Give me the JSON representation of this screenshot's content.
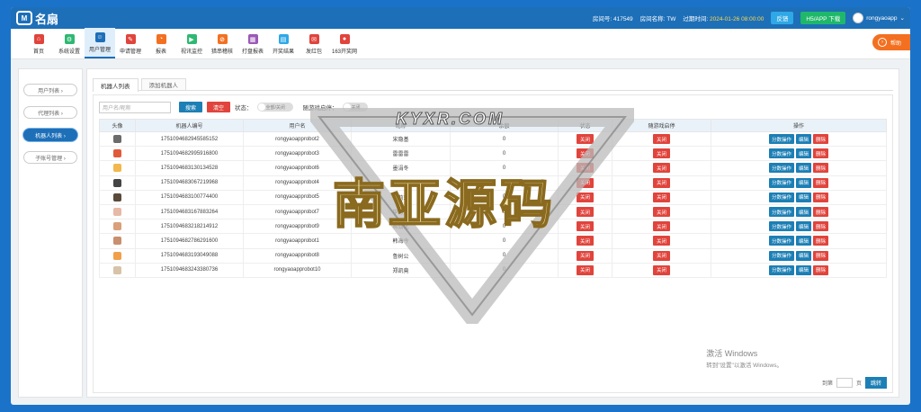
{
  "app": {
    "logo_badge": "M",
    "logo_text": "名扇"
  },
  "topbar": {
    "room_no_label": "房间号:",
    "room_no": "417549",
    "room_name_label": "房间名称:",
    "room_name": "TW",
    "expire_label": "过期时间:",
    "expire": "2024-01-26 08:00:00",
    "feedback": "反馈",
    "h5_download": "H5/APP 下载",
    "user": "rongyaoapp"
  },
  "nav": [
    {
      "label": "首页",
      "color": "#e0443c",
      "glyph": "⌂"
    },
    {
      "label": "系统设置",
      "color": "#2eb872",
      "glyph": "⚙"
    },
    {
      "label": "用户管理",
      "color": "#1d6fb8",
      "glyph": "☺"
    },
    {
      "label": "申请管理",
      "color": "#e0443c",
      "glyph": "✎"
    },
    {
      "label": "报表",
      "color": "#f37021",
      "glyph": "◔"
    },
    {
      "label": "视讯监控",
      "color": "#2eb872",
      "glyph": "▶"
    },
    {
      "label": "猎串稽核",
      "color": "#f37021",
      "glyph": "⊘"
    },
    {
      "label": "打盘报表",
      "color": "#9b59b6",
      "glyph": "▦"
    },
    {
      "label": "开奖结果",
      "color": "#2ea8e6",
      "glyph": "▤"
    },
    {
      "label": "发红包",
      "color": "#e0443c",
      "glyph": "✉"
    },
    {
      "label": "163开奖网",
      "color": "#e0443c",
      "glyph": "●"
    }
  ],
  "help_label": "帮助",
  "sidebar": [
    {
      "label": "用户列表 ›"
    },
    {
      "label": "代理列表 ›"
    },
    {
      "label": "机器人列表 ›"
    },
    {
      "label": "子账号管理 ›"
    }
  ],
  "tabs": [
    "机器人列表",
    "添加机器人"
  ],
  "filter": {
    "placeholder": "用户名/昵称",
    "search": "搜索",
    "clear": "清空",
    "status_label": "状态：",
    "status_toggle": "全部/关闭",
    "follow_label": "随游戏启停：",
    "follow_toggle": "关闭"
  },
  "table": {
    "headers": [
      "头像",
      "机器人编号",
      "用户名",
      "昵称",
      "余额",
      "状态",
      "随游戏启停",
      "操作"
    ],
    "rows": [
      {
        "avatar": "#6b6b6b",
        "id": "1751094682945585152",
        "user": "rongyaoapprobot2",
        "nick": "宋隐基",
        "bal": "0"
      },
      {
        "avatar": "#e05a3a",
        "id": "1751094682995916800",
        "user": "rongyaoapprobot3",
        "nick": "雷雷雷",
        "bal": "0"
      },
      {
        "avatar": "#f2b84b",
        "id": "1751094683130134528",
        "user": "rongyaoapprobot6",
        "nick": "墨涓冬",
        "bal": "0"
      },
      {
        "avatar": "#444444",
        "id": "1751094683067219968",
        "user": "rongyaoapprobot4",
        "nick": "鲁酒旺",
        "bal": "0"
      },
      {
        "avatar": "#5a4a3a",
        "id": "1751094683100774400",
        "user": "rongyaoapprobot5",
        "nick": "苗莉莉",
        "bal": "0"
      },
      {
        "avatar": "#e7b9a6",
        "id": "1751094683167883264",
        "user": "rongyaoapprobot7",
        "nick": "毕可动",
        "bal": "0"
      },
      {
        "avatar": "#d9a07a",
        "id": "1751094683218214912",
        "user": "rongyaoapprobot9",
        "nick": "蒋劲化",
        "bal": "0"
      },
      {
        "avatar": "#c98f6e",
        "id": "1751094682786291600",
        "user": "rongyaoapprobot1",
        "nick": "韩海今",
        "bal": "0"
      },
      {
        "avatar": "#f0a04b",
        "id": "1751094683193049088",
        "user": "rongyaoapprobot8",
        "nick": "鲁树公",
        "bal": "0"
      },
      {
        "avatar": "#d8c2a8",
        "id": "1751094683243380736",
        "user": "rongyaoapprobot10",
        "nick": "郑凯竟",
        "bal": "0"
      }
    ],
    "status_btn": "关闭",
    "follow_btn": "关闭",
    "act_score": "分数操作",
    "act_edit": "编辑",
    "act_delete": "删除"
  },
  "pager": {
    "goto_label": "到第",
    "page_unit": "页",
    "confirm": "跳转"
  },
  "windows_mark": {
    "title": "激活 Windows",
    "sub": "转到\"设置\"以激活 Windows。"
  },
  "watermark": {
    "top": "KYXR.COM",
    "main": "南亚源码"
  }
}
